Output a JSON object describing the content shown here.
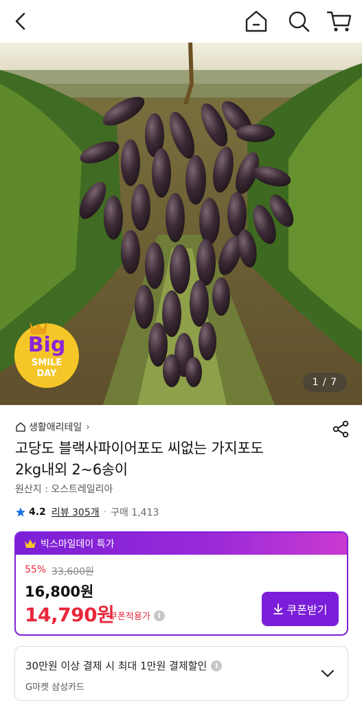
{
  "header": {
    "back_icon": "chevron-left-icon",
    "home_icon": "home-icon",
    "search_icon": "search-icon",
    "cart_icon": "cart-icon"
  },
  "hero": {
    "badge_top": "Big",
    "badge_mid": "SMILE",
    "badge_bottom": "DAY",
    "pager": "1 / 7"
  },
  "product": {
    "store": "생활애리테일",
    "title_line1": "고당도 블랙사파이어포도 씨없는 가지포도",
    "title_line2": "2kg내외 2~6송이",
    "origin": "원산지 : 오스트레일리아",
    "rating": "4.2",
    "review": "리뷰 305개",
    "separator": "·",
    "sales": "구매 1,413"
  },
  "deal": {
    "header_label": "빅스마일데이 특가",
    "discount": "55%",
    "original_price": "33,600원",
    "sale_price": "16,800원",
    "coupon_price": "14,790원",
    "coupon_note": "쿠폰적용가",
    "coupon_button": "쿠폰받기",
    "accent": "#7b1ed9",
    "price_red": "#e8273b"
  },
  "promo": {
    "line1": "30만원 이상 결제 시 최대 1만원 결제할인",
    "line2": "G마켓 삼성카드"
  }
}
